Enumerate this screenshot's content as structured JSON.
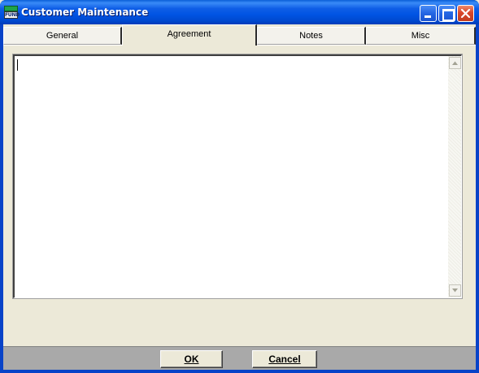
{
  "window": {
    "title": "Customer Maintenance",
    "icon_label": "FUND"
  },
  "tabs": [
    {
      "label": "General",
      "selected": false
    },
    {
      "label": "Agreement",
      "selected": true
    },
    {
      "label": "Notes",
      "selected": false
    },
    {
      "label": "Misc",
      "selected": false
    }
  ],
  "agreement": {
    "text": ""
  },
  "footer": {
    "ok_label": "OK",
    "cancel_label": "Cancel"
  },
  "colors": {
    "titlebar": "#0054e3",
    "close_button": "#d9462a",
    "dialog_face": "#ece9d8",
    "footer_bar": "#a9a9a9"
  },
  "icons": [
    "app-fund-icon",
    "minimize-icon",
    "maximize-icon",
    "close-icon",
    "scroll-up-arrow-icon",
    "scroll-down-arrow-icon"
  ]
}
